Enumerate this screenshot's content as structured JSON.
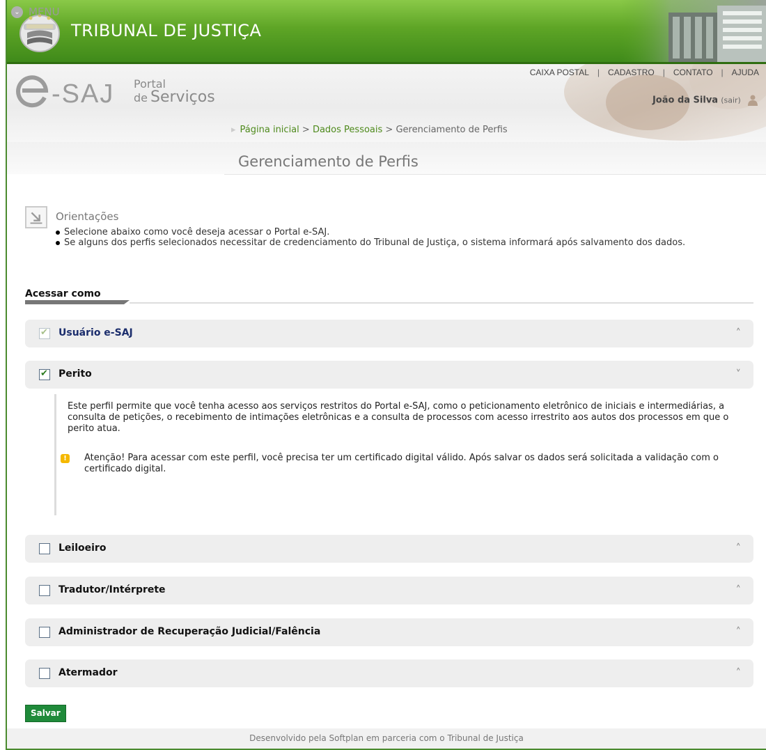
{
  "header": {
    "title": "TRIBUNAL DE JUSTIÇA",
    "brand": {
      "e": "e",
      "saj": "-SAJ",
      "portal": "Portal",
      "de": "de",
      "servicos": "Serviços"
    }
  },
  "toplinks": [
    {
      "label": "CAIXA POSTAL"
    },
    {
      "label": "CADASTRO"
    },
    {
      "label": "CONTATO"
    },
    {
      "label": "AJUDA"
    }
  ],
  "user": {
    "name": "João da Silva",
    "logout": "(sair)"
  },
  "breadcrumb": {
    "items": [
      "Página inicial",
      "Dados Pessoais",
      "Gerenciamento de Perfis"
    ],
    "separator": ">"
  },
  "menu": {
    "label": "MENU"
  },
  "page_title": "Gerenciamento de Perfis",
  "orientacoes": {
    "title": "Orientações",
    "items": [
      "Selecione abaixo como você deseja acessar o Portal e-SAJ.",
      "Se alguns dos perfis selecionados necessitar de credenciamento do Tribunal de Justiça, o sistema informará após salvamento dos dados."
    ]
  },
  "section_title": "Acessar como",
  "profiles": [
    {
      "label": "Usuário e-SAJ",
      "checked": true,
      "disabled": true,
      "expanded": false
    },
    {
      "label": "Perito",
      "checked": true,
      "disabled": false,
      "expanded": true
    },
    {
      "label": "Leiloeiro",
      "checked": false,
      "disabled": false,
      "expanded": false
    },
    {
      "label": "Tradutor/Intérprete",
      "checked": false,
      "disabled": false,
      "expanded": false
    },
    {
      "label": "Administrador de Recuperação Judicial/Falência",
      "checked": false,
      "disabled": false,
      "expanded": false
    },
    {
      "label": "Atermador",
      "checked": false,
      "disabled": false,
      "expanded": false
    }
  ],
  "perito_detail": {
    "description": "Este perfil permite que você tenha acesso aos serviços restritos do Portal e-SAJ, como o peticionamento eletrônico de iniciais e intermediárias, a consulta de petições, o recebimento de intimações eletrônicas e a consulta de processos com acesso irrestrito aos autos dos processos em que o perito atua.",
    "warning": "Atenção! Para acessar com este perfil, você precisa ter um certificado digital válido. Após salvar os dados será solicitada a validação com o certificado digital."
  },
  "save_label": "Salvar",
  "footer_text": "Desenvolvido pela Softplan em parceria com o Tribunal de Justiça",
  "icons": {
    "logo": "court-seal-icon",
    "user": "user-icon",
    "menu": "chevron-down-icon",
    "orient": "arrow-down-right-icon",
    "collapse": "double-chevron-up-icon",
    "expand": "double-chevron-down-icon",
    "warning": "exclamation-icon"
  },
  "colors": {
    "brand_green": "#5ea526",
    "link_green": "#4e8a1c",
    "save_green": "#1f8a3a",
    "profile_blue": "#1b2d6c",
    "warning_yellow": "#f5b800"
  }
}
